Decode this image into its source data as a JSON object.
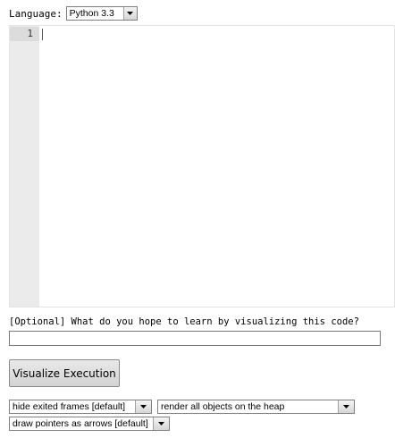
{
  "language": {
    "label": "Language:",
    "selected": "Python 3.3"
  },
  "editor": {
    "line_numbers": [
      "1"
    ],
    "code": ""
  },
  "question": {
    "label": "[Optional] What do you hope to learn by visualizing this code?",
    "value": ""
  },
  "visualize_button": {
    "label": "Visualize Execution"
  },
  "options": {
    "frames": "hide exited frames [default]",
    "heap": "render all objects on the heap",
    "pointers": "draw pointers as arrows [default]"
  },
  "icons": {
    "dropdown": "chevron-down-icon"
  }
}
